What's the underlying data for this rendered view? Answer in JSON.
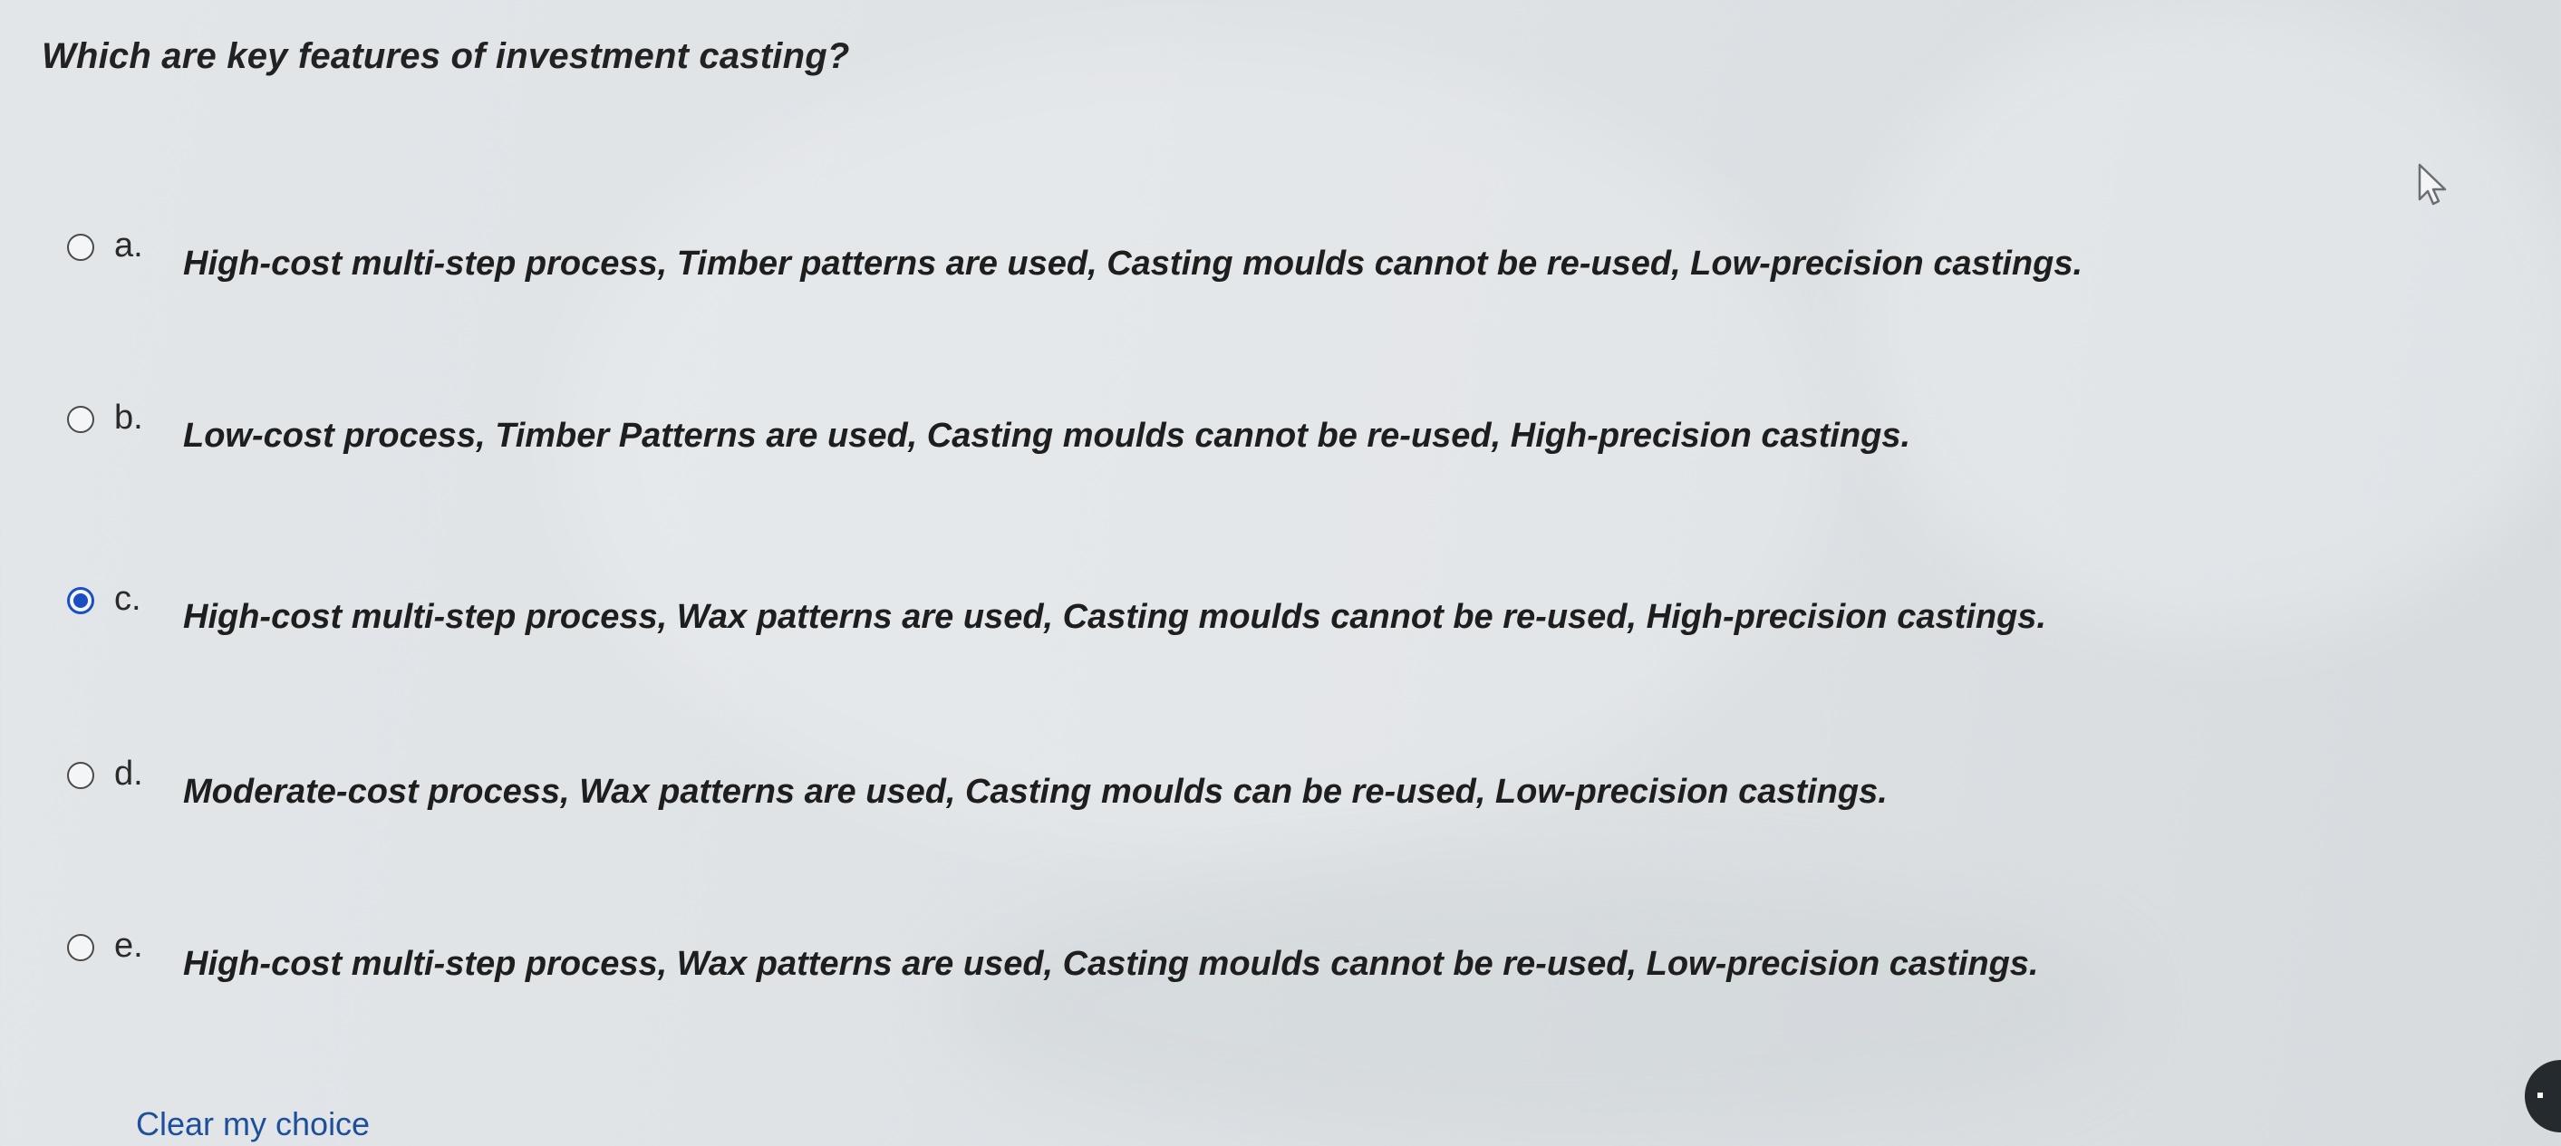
{
  "question": {
    "text": "Which are key features of investment casting?"
  },
  "options": [
    {
      "letter": "a.",
      "text": "High-cost multi-step process, Timber patterns are used, Casting moulds cannot be re-used, Low-precision castings.",
      "selected": false
    },
    {
      "letter": "b.",
      "text": "Low-cost process, Timber Patterns are used, Casting moulds cannot be re-used, High-precision castings.",
      "selected": false
    },
    {
      "letter": "c.",
      "text": "High-cost multi-step process, Wax patterns are used, Casting moulds cannot be re-used, High-precision castings.",
      "selected": true
    },
    {
      "letter": "d.",
      "text": "Moderate-cost process, Wax patterns are used, Casting moulds can be re-used, Low-precision castings.",
      "selected": false
    },
    {
      "letter": "e.",
      "text": "High-cost multi-step process, Wax patterns are used, Casting moulds cannot be re-used, Low-precision castings.",
      "selected": false
    }
  ],
  "clear_choice_label": "Clear my choice",
  "colors": {
    "selected_radio": "#1a4fc4",
    "link": "#1e4f9a",
    "background": "#dfe3e6"
  },
  "icons": {
    "cursor": "mouse-pointer-icon"
  }
}
